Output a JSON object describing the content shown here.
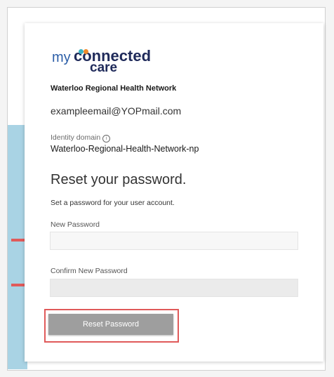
{
  "logo": {
    "my": "my",
    "connected": "connected",
    "care": "care"
  },
  "org_name": "Waterloo Regional Health Network",
  "email": "exampleemail@YOPmail.com",
  "identity_domain": {
    "label": "Identity domain",
    "value": "Waterloo-Regional-Health-Network-np"
  },
  "heading": "Reset your password.",
  "subtext": "Set a password for your user account.",
  "new_password": {
    "label": "New Password",
    "value": ""
  },
  "confirm_password": {
    "label": "Confirm New Password",
    "value": ""
  },
  "reset_button": "Reset Password",
  "colors": {
    "accent_arrow": "#e05a5a",
    "button_bg": "#9e9e9e",
    "logo_dark": "#1f2a5a",
    "logo_blue": "#2d5fa8",
    "blue_strip": "#a9d3e4"
  },
  "icons": [
    "info-icon",
    "annotation-arrow-icon"
  ]
}
